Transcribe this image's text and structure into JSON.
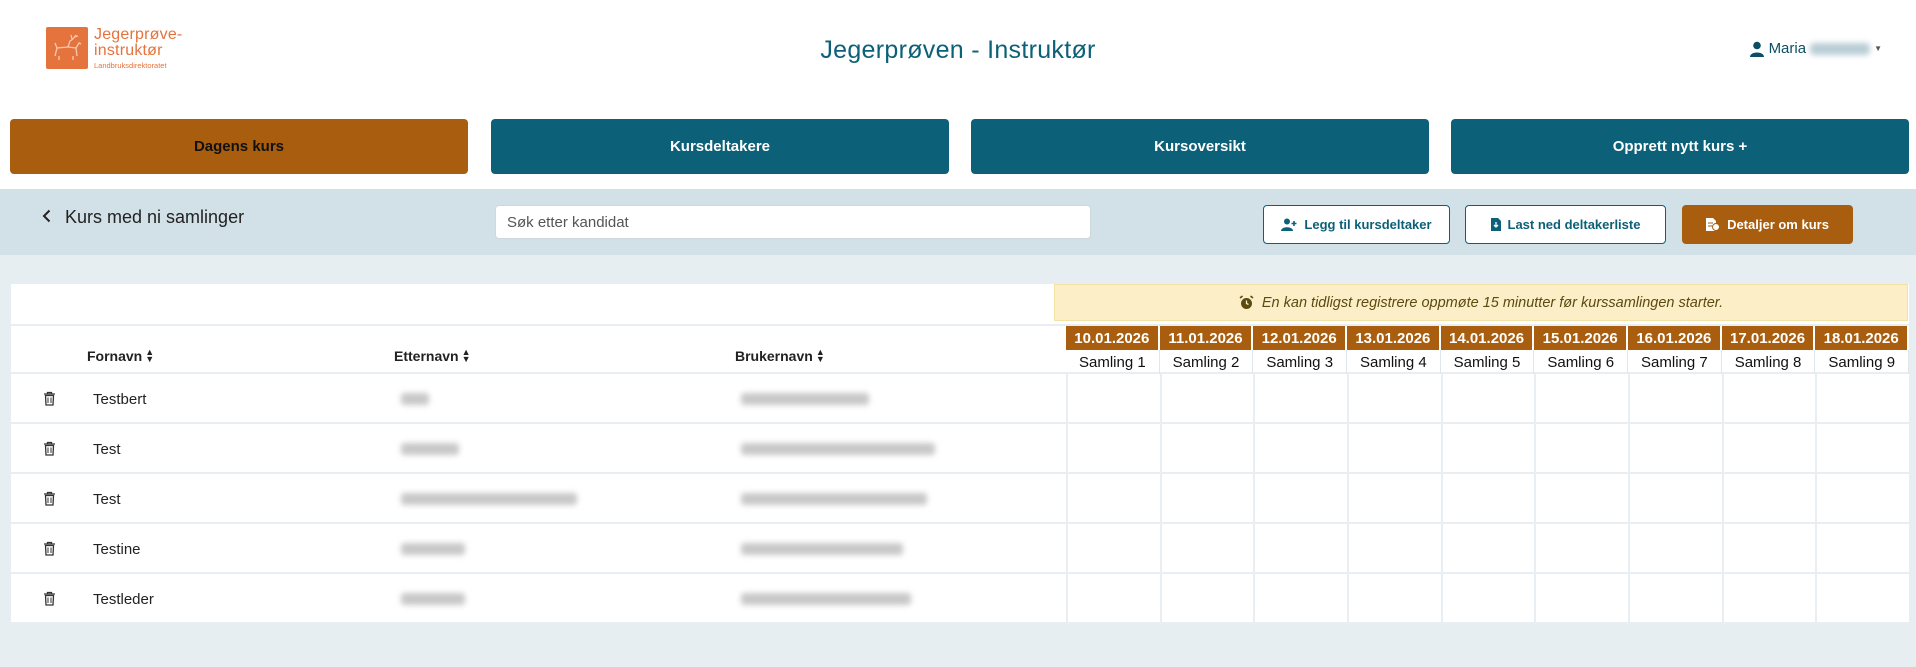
{
  "logo": {
    "line1": "Jegerprøve-",
    "line2": "instruktør",
    "line3": "Landbruksdirektoratet"
  },
  "app_title": "Jegerprøven - Instruktør",
  "user": {
    "first_name": "Maria"
  },
  "nav": [
    {
      "label": "Dagens kurs",
      "active": true
    },
    {
      "label": "Kursdeltakere",
      "active": false
    },
    {
      "label": "Kursoversikt",
      "active": false
    },
    {
      "label": "Opprett nytt kurs +",
      "active": false
    }
  ],
  "course": {
    "back_title": "Kurs med ni samlinger",
    "search_placeholder": "Søk etter kandidat",
    "add_participant": "Legg til kursdeltaker",
    "download_list": "Last ned deltakerliste",
    "course_details": "Detaljer om kurs"
  },
  "notice": "En kan tidligst registrere oppmøte 15 minutter før kurssamlingen starter.",
  "columns": {
    "first_name": "Fornavn",
    "last_name": "Etternavn",
    "username": "Brukernavn"
  },
  "sessions": [
    {
      "date": "10.01.2026",
      "label": "Samling 1"
    },
    {
      "date": "11.01.2026",
      "label": "Samling 2"
    },
    {
      "date": "12.01.2026",
      "label": "Samling 3"
    },
    {
      "date": "13.01.2026",
      "label": "Samling 4"
    },
    {
      "date": "14.01.2026",
      "label": "Samling 5"
    },
    {
      "date": "15.01.2026",
      "label": "Samling 6"
    },
    {
      "date": "16.01.2026",
      "label": "Samling 7"
    },
    {
      "date": "17.01.2026",
      "label": "Samling 8"
    },
    {
      "date": "18.01.2026",
      "label": "Samling 9"
    }
  ],
  "participants": [
    {
      "first_name": "Testbert"
    },
    {
      "first_name": "Test"
    },
    {
      "first_name": "Test"
    },
    {
      "first_name": "Testine"
    },
    {
      "first_name": "Testleder"
    }
  ],
  "colors": {
    "teal": "#0c6178",
    "orange": "#a85e0e",
    "logo_orange": "#e5733d"
  }
}
